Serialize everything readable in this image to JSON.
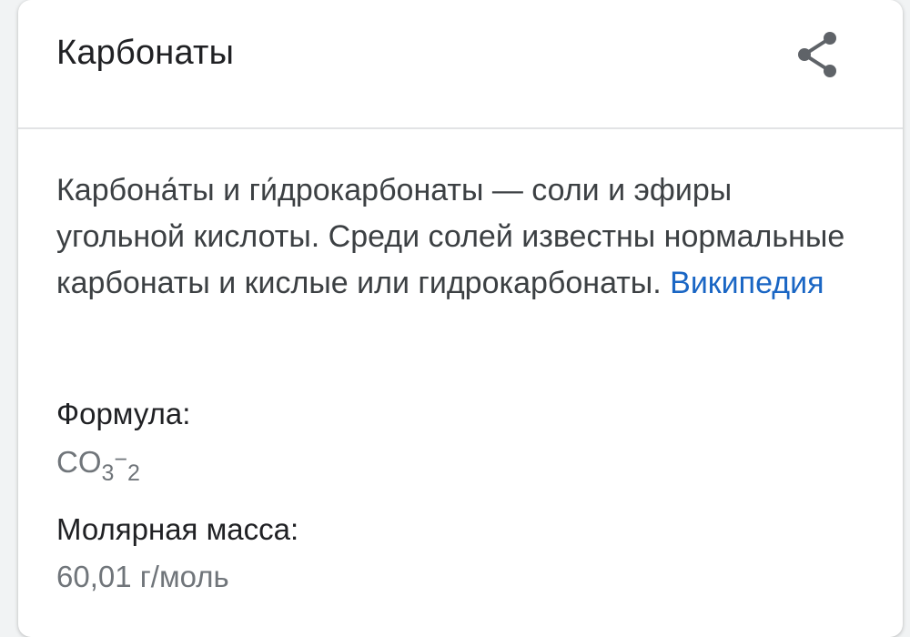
{
  "card": {
    "title": "Карбонаты",
    "share_icon": "share-icon",
    "description": {
      "text": "Карбона́ты и ги́дрокарбонаты — соли и эфиры угольной кислоты. Среди солей известны нормальные карбонаты и кислые или гидрокарбонаты.",
      "source_link": "Википедия"
    },
    "facts": {
      "formula": {
        "label": "Формула:",
        "base": "CO",
        "sub": "3",
        "sup": "−",
        "sub2": "2"
      },
      "molar_mass": {
        "label": "Молярная масса:",
        "value": "60,01 г/моль"
      }
    }
  },
  "colors": {
    "page_background": "#f1f3f4",
    "card_background": "#ffffff",
    "title_text": "#202124",
    "body_text": "#3c4043",
    "secondary_text": "#70757a",
    "link": "#1a66c4",
    "divider": "#e2e3e5",
    "icon": "#5f6368"
  }
}
